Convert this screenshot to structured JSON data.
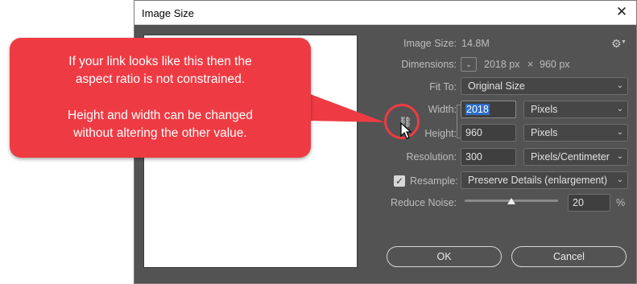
{
  "window": {
    "title": "Image Size",
    "close_glyph": "✕"
  },
  "info": {
    "image_size_label": "Image Size:",
    "image_size_value": "14.8M",
    "dimensions_label": "Dimensions:",
    "dim_width": "2018 px",
    "dim_x": "×",
    "dim_height": "960 px"
  },
  "fit_to": {
    "label": "Fit To:",
    "value": "Original Size"
  },
  "width": {
    "label": "Width:",
    "value": "2018",
    "unit": "Pixels"
  },
  "height": {
    "label": "Height:",
    "value": "960",
    "unit": "Pixels"
  },
  "resolution": {
    "label": "Resolution:",
    "value": "300",
    "unit": "Pixels/Centimeter"
  },
  "resample": {
    "label": "Resample:",
    "checked": true,
    "value": "Preserve Details (enlargement)"
  },
  "reduce_noise": {
    "label": "Reduce Noise:",
    "value": "20",
    "unit": "%",
    "level_fraction": 0.5
  },
  "buttons": {
    "ok": "OK",
    "cancel": "Cancel"
  },
  "callout": {
    "line1": "If your link looks like this then the",
    "line2": "aspect ratio is not constrained.",
    "line3": "Height and width can be changed",
    "line4": "without altering the other value."
  },
  "icons": {
    "gear": "gear-icon",
    "chevron": "chevron-down-icon",
    "link": "unlinked-chain-icon",
    "cursor": "arrow-cursor-icon"
  },
  "colors": {
    "dialog_bg": "#535353",
    "callout_red": "#ee3b43",
    "selection_blue": "#2d6cc4"
  }
}
